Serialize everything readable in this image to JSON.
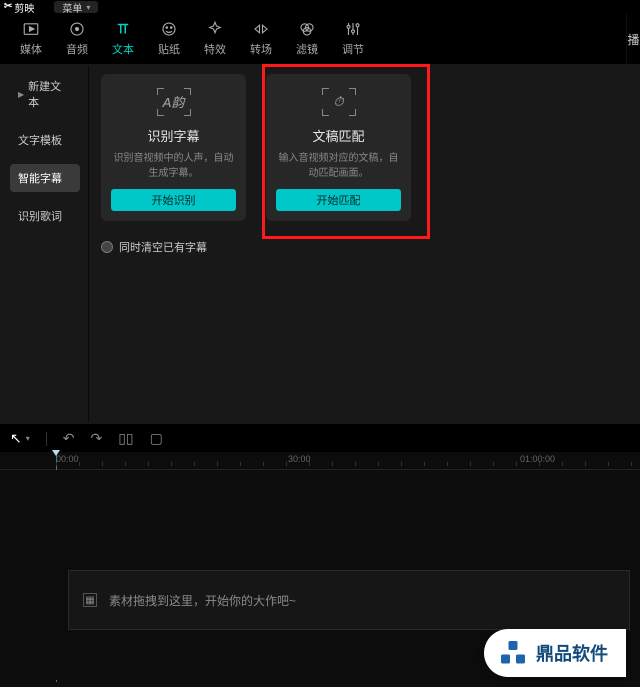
{
  "titlebar": {
    "app_name": "剪映",
    "menu_label": "菜单"
  },
  "categories": [
    {
      "id": "media",
      "label": "媒体"
    },
    {
      "id": "audio",
      "label": "音频"
    },
    {
      "id": "text",
      "label": "文本",
      "active": true
    },
    {
      "id": "sticker",
      "label": "贴纸"
    },
    {
      "id": "effect",
      "label": "特效"
    },
    {
      "id": "transition",
      "label": "转场"
    },
    {
      "id": "filter",
      "label": "滤镜"
    },
    {
      "id": "adjust",
      "label": "调节"
    }
  ],
  "right_edge_label": "播",
  "sidebar": {
    "items": [
      {
        "label": "新建文本",
        "expandable": true
      },
      {
        "label": "文字模板"
      },
      {
        "label": "智能字幕",
        "active": true
      },
      {
        "label": "识别歌词"
      }
    ]
  },
  "cards": [
    {
      "title": "识别字幕",
      "desc": "识别音视频中的人声，自动生成字幕。",
      "button": "开始识别",
      "glyph": "A韵"
    },
    {
      "title": "文稿匹配",
      "desc": "输入音视频对应的文稿，自动匹配画面。",
      "button": "开始匹配",
      "glyph": "⏱"
    }
  ],
  "checkbox_label": "同时清空已有字幕",
  "ruler_marks": [
    {
      "pos": 56,
      "label": "00:00"
    },
    {
      "pos": 288,
      "label": "30:00"
    },
    {
      "pos": 520,
      "label": "01:00:00"
    }
  ],
  "track_hint": "素材拖拽到这里，开始你的大作吧~",
  "watermark_text": "鼎品软件"
}
